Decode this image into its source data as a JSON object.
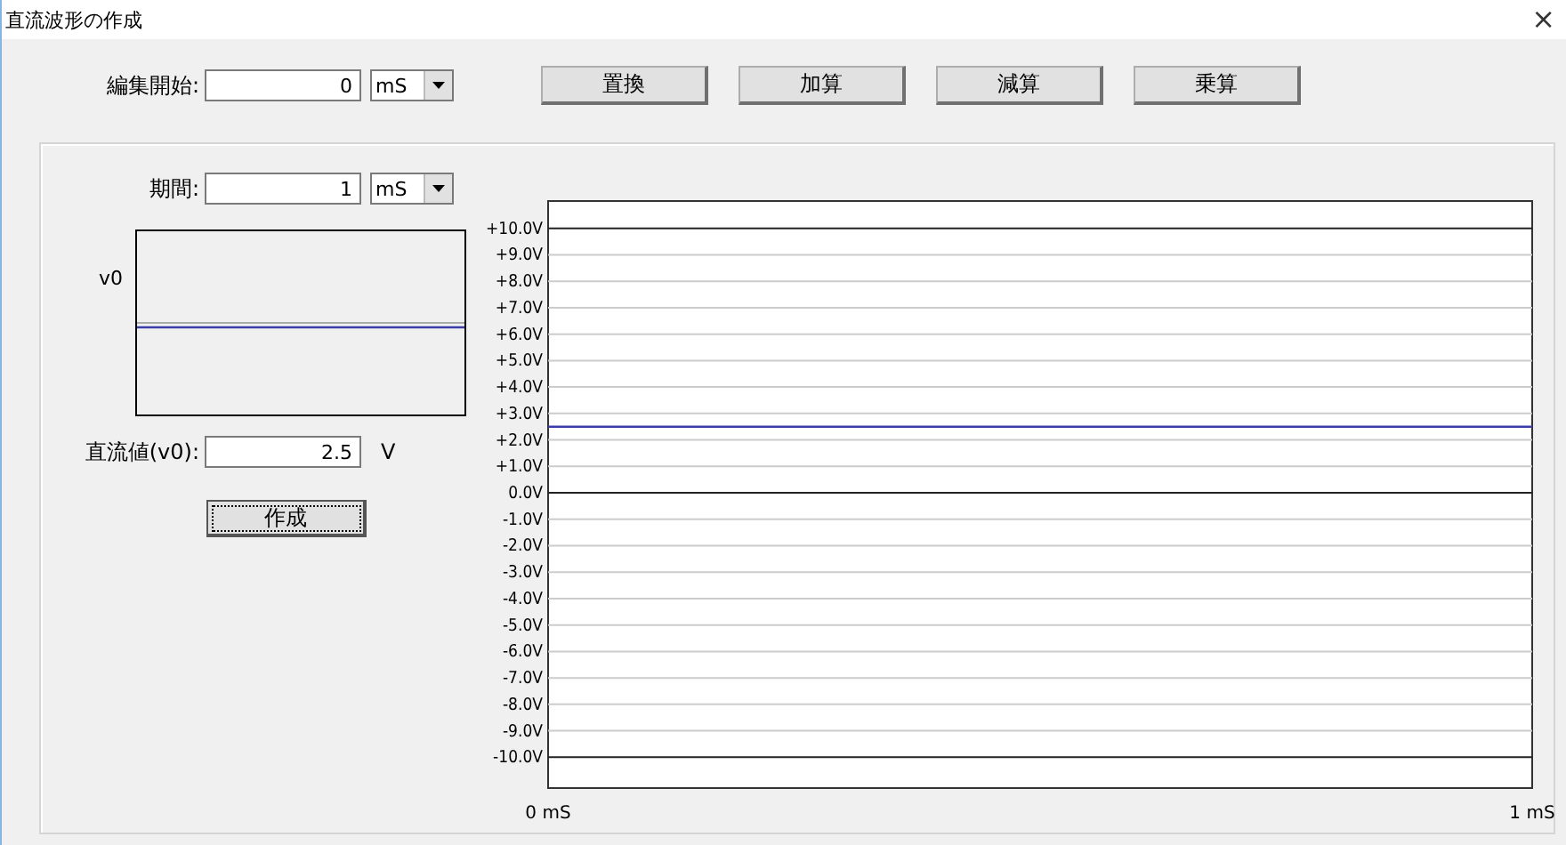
{
  "window": {
    "title": "直流波形の作成",
    "close": "×"
  },
  "edit_start": {
    "label": "編集開始:",
    "value": "0",
    "unit": "mS"
  },
  "actions": [
    "置換",
    "加算",
    "減算",
    "乗算"
  ],
  "period": {
    "label": "期間:",
    "value": "1",
    "unit": "mS"
  },
  "dc_value": {
    "label": "直流値(v0):",
    "value": "2.5",
    "unit": "V"
  },
  "create_button": {
    "label": "作成",
    "focused": true
  },
  "chart_data": {
    "type": "line",
    "grid": true,
    "x": [
      0,
      1
    ],
    "xlim": [
      0,
      1
    ],
    "ylim": [
      -11.2,
      11.0
    ],
    "series": [
      {
        "name": "v0",
        "color": "#3c3ca8",
        "values": [
          2.5,
          2.5
        ]
      }
    ],
    "xticks": [
      {
        "value": 0,
        "label": "0 mS"
      },
      {
        "value": 1,
        "label": "1 mS"
      }
    ],
    "yticks": [
      {
        "value": 10,
        "label": "+10.0V"
      },
      {
        "value": 9,
        "label": "+9.0V"
      },
      {
        "value": 8,
        "label": "+8.0V"
      },
      {
        "value": 7,
        "label": "+7.0V"
      },
      {
        "value": 6,
        "label": "+6.0V"
      },
      {
        "value": 5,
        "label": "+5.0V"
      },
      {
        "value": 4,
        "label": "+4.0V"
      },
      {
        "value": 3,
        "label": "+3.0V"
      },
      {
        "value": 2,
        "label": "+2.0V"
      },
      {
        "value": 1,
        "label": "+1.0V"
      },
      {
        "value": 0,
        "label": "0.0V"
      },
      {
        "value": -1,
        "label": "-1.0V"
      },
      {
        "value": -2,
        "label": "-2.0V"
      },
      {
        "value": -3,
        "label": "-3.0V"
      },
      {
        "value": -4,
        "label": "-4.0V"
      },
      {
        "value": -5,
        "label": "-5.0V"
      },
      {
        "value": -6,
        "label": "-6.0V"
      },
      {
        "value": -7,
        "label": "-7.0V"
      },
      {
        "value": -8,
        "label": "-8.0V"
      },
      {
        "value": -9,
        "label": "-9.0V"
      },
      {
        "value": -10,
        "label": "-10.0V"
      }
    ]
  }
}
